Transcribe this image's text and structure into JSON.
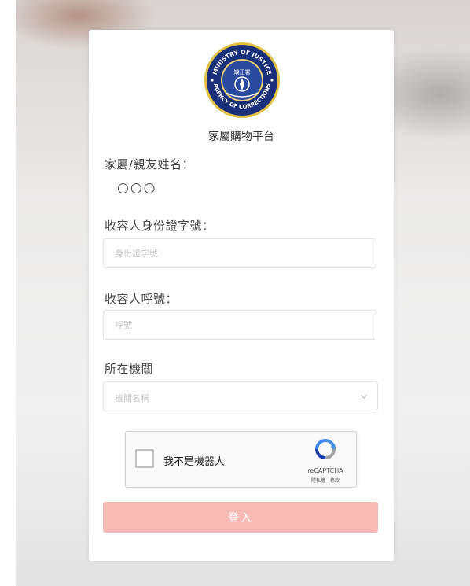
{
  "platform_title": "家屬購物平台",
  "logo": {
    "top_text": "MINISTRY OF JUSTICE",
    "bottom_text": "AGENCY OF CORRECTIONS",
    "center_text": "矯正署",
    "colors": {
      "ring": "#1a2f7a",
      "border": "#e0c040",
      "inner": "#2a4aa0"
    }
  },
  "form": {
    "family_name_label": "家屬/親友姓名：",
    "family_name_value": "○○○",
    "id_label": "收容人身份證字號：",
    "id_placeholder": "身份證字號",
    "inmate_number_label": "收容人呼號：",
    "inmate_number_placeholder": "呼號",
    "institution_label": "所在機關",
    "institution_placeholder": "機關名稱",
    "select_icon": "chevron-down-icon"
  },
  "captcha": {
    "label": "我不是機器人",
    "brand": "reCAPTCHA",
    "links": "隱私權 - 條款",
    "icon": "recaptcha-icon"
  },
  "login_button": "登入",
  "colors": {
    "button": "#f7b9b3",
    "text": "#444444"
  }
}
